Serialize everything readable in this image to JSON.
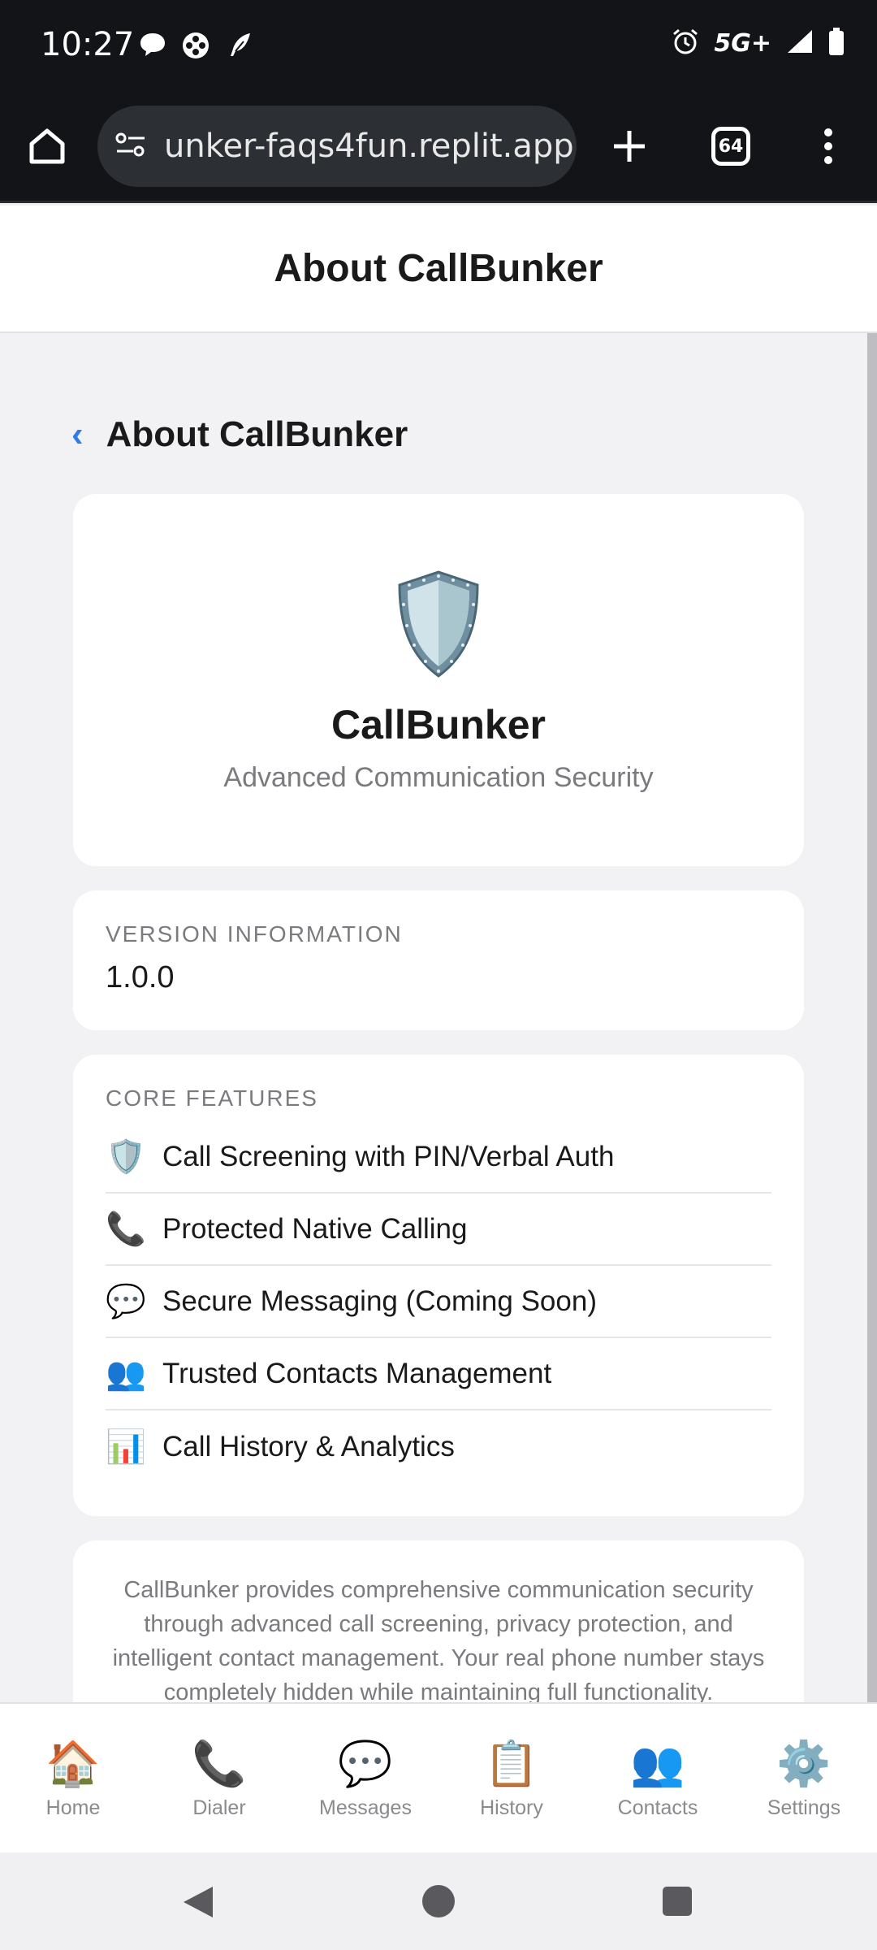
{
  "status_bar": {
    "time": "10:27",
    "network": "5G+"
  },
  "browser": {
    "url": "unker-faqs4fun.replit.app",
    "tab_count": "64"
  },
  "page_header": {
    "title": "About CallBunker"
  },
  "subheader": {
    "title": "About CallBunker"
  },
  "hero": {
    "app_name": "CallBunker",
    "tagline": "Advanced Communication Security"
  },
  "version": {
    "label": "VERSION INFORMATION",
    "value": "1.0.0"
  },
  "features": {
    "label": "CORE FEATURES",
    "items": [
      {
        "icon": "shield-icon",
        "glyph": "🛡️",
        "text": "Call Screening with PIN/Verbal Auth"
      },
      {
        "icon": "phone-icon",
        "glyph": "📞",
        "text": "Protected Native Calling"
      },
      {
        "icon": "speech-bubble-icon",
        "glyph": "💬",
        "text": "Secure Messaging (Coming Soon)"
      },
      {
        "icon": "people-icon",
        "glyph": "👥",
        "text": "Trusted Contacts Management"
      },
      {
        "icon": "bar-chart-icon",
        "glyph": "📊",
        "text": "Call History & Analytics"
      }
    ]
  },
  "about_text": "CallBunker provides comprehensive communication security through advanced call screening, privacy protection, and intelligent contact management. Your real phone number stays completely hidden while maintaining full functionality.",
  "bottom_nav": {
    "items": [
      {
        "label": "Home",
        "icon": "house-icon",
        "glyph": "🏠"
      },
      {
        "label": "Dialer",
        "icon": "phone-icon",
        "glyph": "📞"
      },
      {
        "label": "Messages",
        "icon": "speech-bubble-icon",
        "glyph": "💬"
      },
      {
        "label": "History",
        "icon": "clipboard-icon",
        "glyph": "📋"
      },
      {
        "label": "Contacts",
        "icon": "people-icon",
        "glyph": "👥"
      },
      {
        "label": "Settings",
        "icon": "gear-icon",
        "glyph": "⚙️"
      }
    ]
  },
  "colors": {
    "accent": "#2f7ee8",
    "background": "#f2f2f4",
    "card": "#ffffff",
    "browser_chrome": "#121417"
  }
}
